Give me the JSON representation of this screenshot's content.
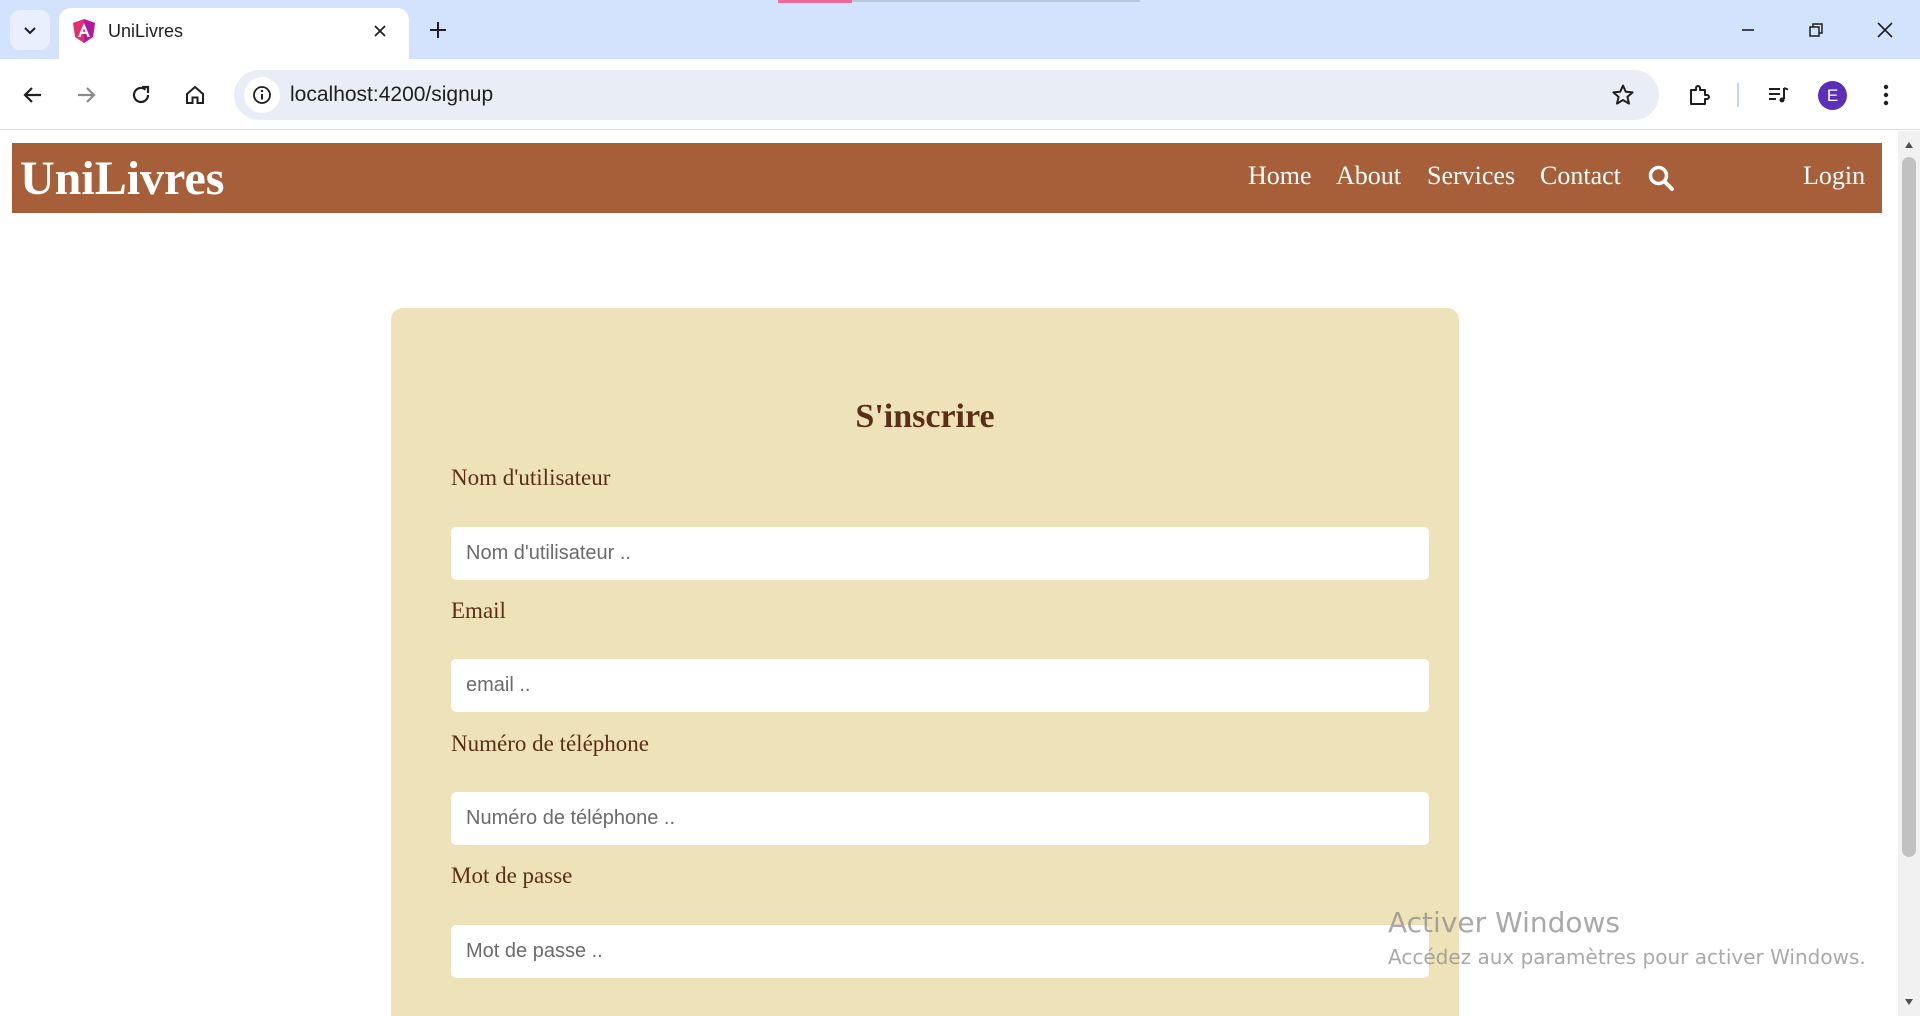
{
  "browser": {
    "tab_title": "UniLivres",
    "url": "localhost:4200/signup",
    "profile_initial": "E"
  },
  "site": {
    "brand": "UniLivres",
    "nav": {
      "home": "Home",
      "about": "About",
      "services": "Services",
      "contact": "Contact",
      "login": "Login"
    }
  },
  "form": {
    "title": "S'inscrire",
    "fields": [
      {
        "label": "Nom d'utilisateur",
        "placeholder": "Nom d'utilisateur .."
      },
      {
        "label": "Email",
        "placeholder": "email .."
      },
      {
        "label": "Numéro de téléphone",
        "placeholder": "Numéro de téléphone .."
      },
      {
        "label": "Mot de passe",
        "placeholder": "Mot de passe .."
      }
    ]
  },
  "watermark": {
    "title": "Activer Windows",
    "subtitle": "Accédez aux paramètres pour activer Windows."
  },
  "colors": {
    "navbar": "#a65f38",
    "card": "#eee3b8",
    "label_text": "#5a2e17",
    "tabstrip": "#d3e3fd"
  }
}
